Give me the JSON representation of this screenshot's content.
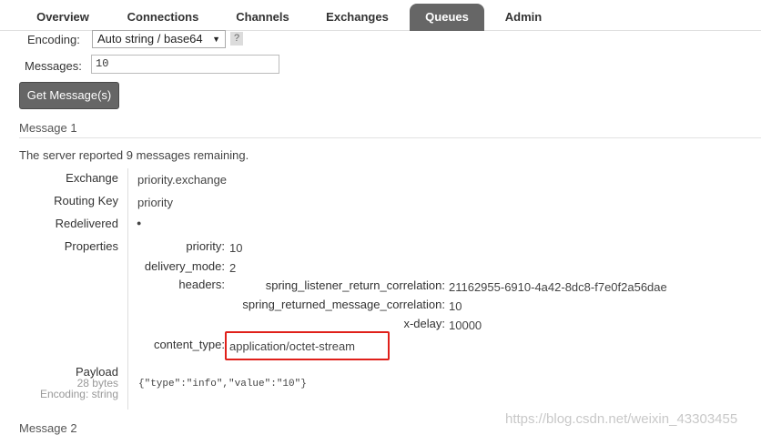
{
  "tabs": [
    {
      "label": "Overview",
      "active": false
    },
    {
      "label": "Connections",
      "active": false
    },
    {
      "label": "Channels",
      "active": false
    },
    {
      "label": "Exchanges",
      "active": false
    },
    {
      "label": "Queues",
      "active": true
    },
    {
      "label": "Admin",
      "active": false
    }
  ],
  "form": {
    "encoding_label": "Encoding:",
    "encoding_value": "Auto string / base64",
    "help_label": "?",
    "messages_label": "Messages:",
    "messages_value": "10",
    "get_button": "Get Message(s)"
  },
  "message1": {
    "title": "Message 1",
    "remaining_prefix": "The server reported ",
    "remaining_count": "9",
    "remaining_suffix": " messages remaining.",
    "exchange_label": "Exchange",
    "exchange_value": "priority.exchange",
    "routing_key_label": "Routing Key",
    "routing_key_value": "priority",
    "redelivered_label": "Redelivered",
    "redelivered_value": "●",
    "properties_label": "Properties",
    "properties": {
      "priority_label": "priority:",
      "priority_value": "10",
      "delivery_mode_label": "delivery_mode:",
      "delivery_mode_value": "2",
      "headers_label": "headers:",
      "headers": {
        "return_corr_label": "spring_listener_return_correlation:",
        "return_corr_value": "21162955-6910-4a42-8dc8-f7e0f2a56dae",
        "returned_msg_label": "spring_returned_message_correlation:",
        "returned_msg_value": "10",
        "x_delay_label": "x-delay:",
        "x_delay_value": "10000"
      },
      "content_type_label": "content_type:",
      "content_type_value": "application/octet-stream"
    },
    "payload_label": "Payload",
    "payload_size": "28 bytes",
    "payload_encoding": "Encoding: string",
    "payload_value": "{\"type\":\"info\",\"value\":\"10\"}"
  },
  "message2": {
    "title": "Message 2"
  },
  "watermark": "https://blog.csdn.net/weixin_43303455",
  "colors": {
    "tab_active_bg": "#666666",
    "button_bg": "#666666",
    "highlight_border": "#e0201a"
  }
}
